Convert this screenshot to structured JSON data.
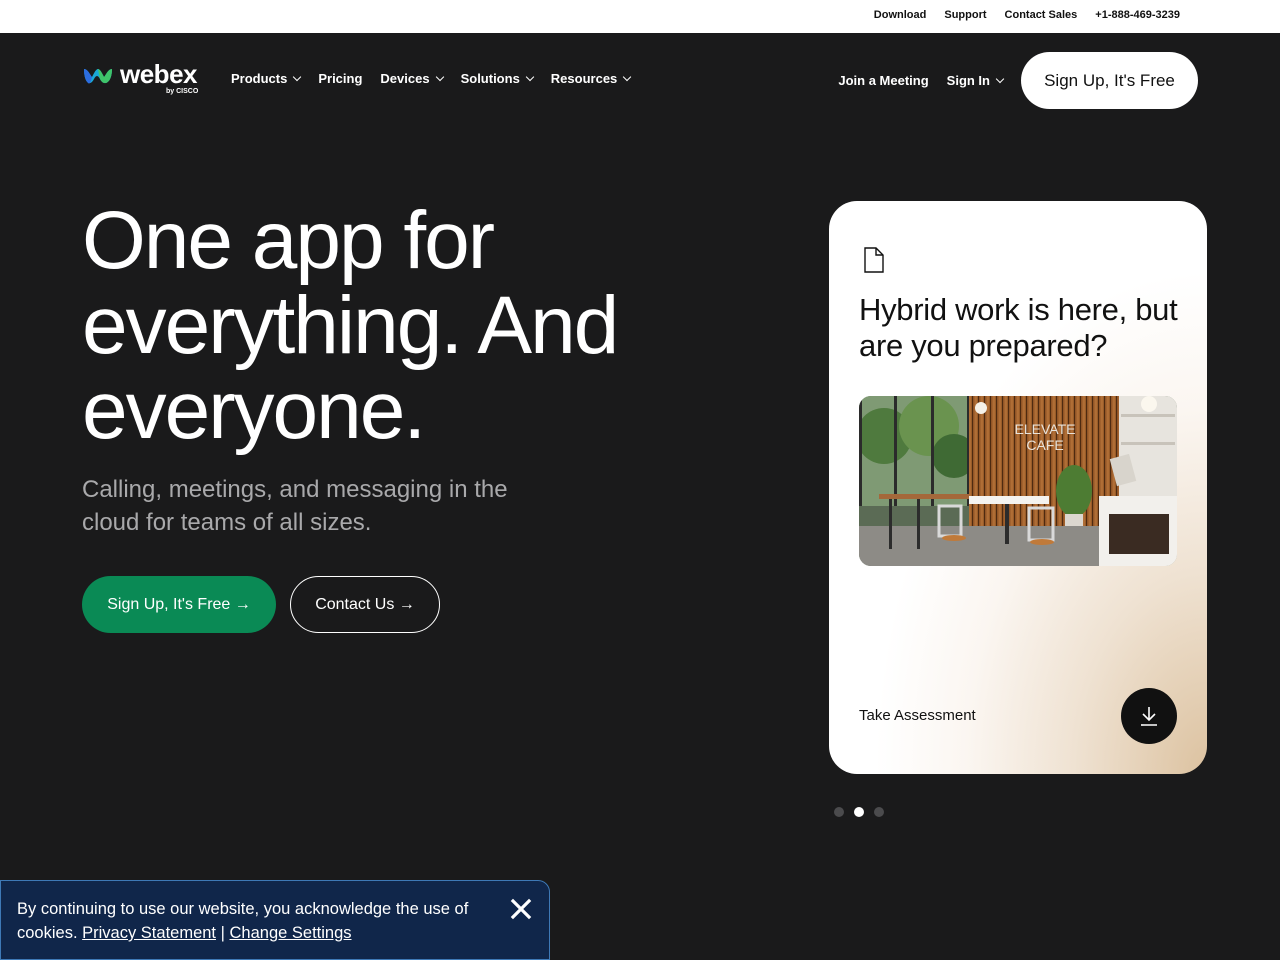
{
  "utility": {
    "download": "Download",
    "support": "Support",
    "contact_sales": "Contact Sales",
    "phone": "+1-888-469-3239"
  },
  "nav": {
    "logo_word": "webex",
    "logo_by": "by CISCO",
    "items": [
      {
        "label": "Products",
        "dropdown": true
      },
      {
        "label": "Pricing",
        "dropdown": false
      },
      {
        "label": "Devices",
        "dropdown": true
      },
      {
        "label": "Solutions",
        "dropdown": true
      },
      {
        "label": "Resources",
        "dropdown": true
      }
    ],
    "join_meeting": "Join a Meeting",
    "sign_in": "Sign In",
    "signup_button": "Sign Up, It's Free"
  },
  "hero": {
    "title_line1": "One app for",
    "title_line2": "everything. And",
    "title_line3": "everyone.",
    "subtitle": "Calling, meetings, and messaging in the cloud for teams of all sizes.",
    "cta_primary": "Sign Up, It's Free →",
    "cta_secondary": "Contact Us →"
  },
  "card": {
    "icon": "document-icon",
    "title": "Hybrid work is here, but are you prepared?",
    "image_sign": "ELEVATE CAFE",
    "action_label": "Take Assessment",
    "action_icon": "download-icon"
  },
  "carousel": {
    "count": 3,
    "active_index": 1
  },
  "cookie": {
    "text": "By continuing to use our website, you acknowledge the use of cookies.",
    "privacy_link": "Privacy Statement",
    "separator": "|",
    "settings_link": "Change Settings"
  },
  "colors": {
    "background": "#1a1a1b",
    "primary_green": "#0a8a55",
    "cookie_bg": "#10264a"
  }
}
